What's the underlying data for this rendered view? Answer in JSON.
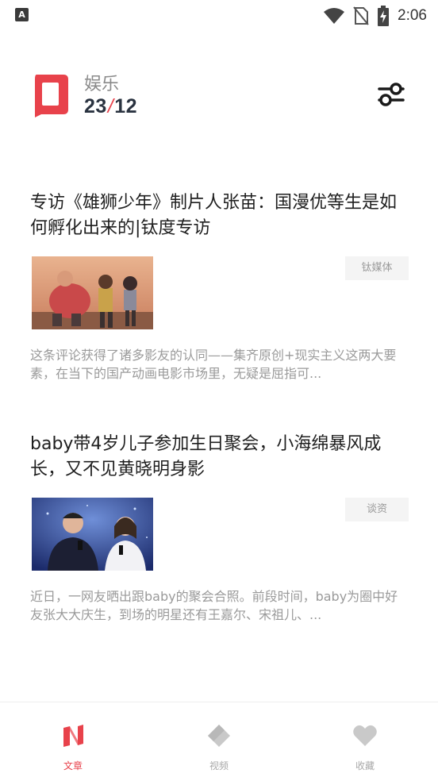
{
  "status_bar": {
    "time": "2:06",
    "app_icon_letter": "A"
  },
  "header": {
    "category": "娱乐",
    "date_day": "23",
    "date_month": "12",
    "brand_color": "#e8424b"
  },
  "articles": [
    {
      "title": "专访《雄狮少年》制片人张苗：国漫优等生是如何孵化出来的|钛度专访",
      "source": "钛媒体",
      "summary": "这条评论获得了诸多影友的认同——集齐原创+现实主义这两大要素，在当下的国产动画电影市场里，无疑是屈指可..."
    },
    {
      "title": "baby带4岁儿子参加生日聚会，小海绵暴风成长，又不见黄晓明身影",
      "source": "谈资",
      "summary": "近日，一网友晒出跟baby的聚会合照。前段时间，baby为圈中好友张大大庆生，到场的明星还有王嘉尔、宋祖儿、..."
    }
  ],
  "bottom_nav": {
    "items": [
      {
        "label": "文章",
        "icon": "article-n-icon",
        "active": true
      },
      {
        "label": "视频",
        "icon": "video-diamond-icon",
        "active": false
      },
      {
        "label": "收藏",
        "icon": "heart-icon",
        "active": false
      }
    ]
  }
}
